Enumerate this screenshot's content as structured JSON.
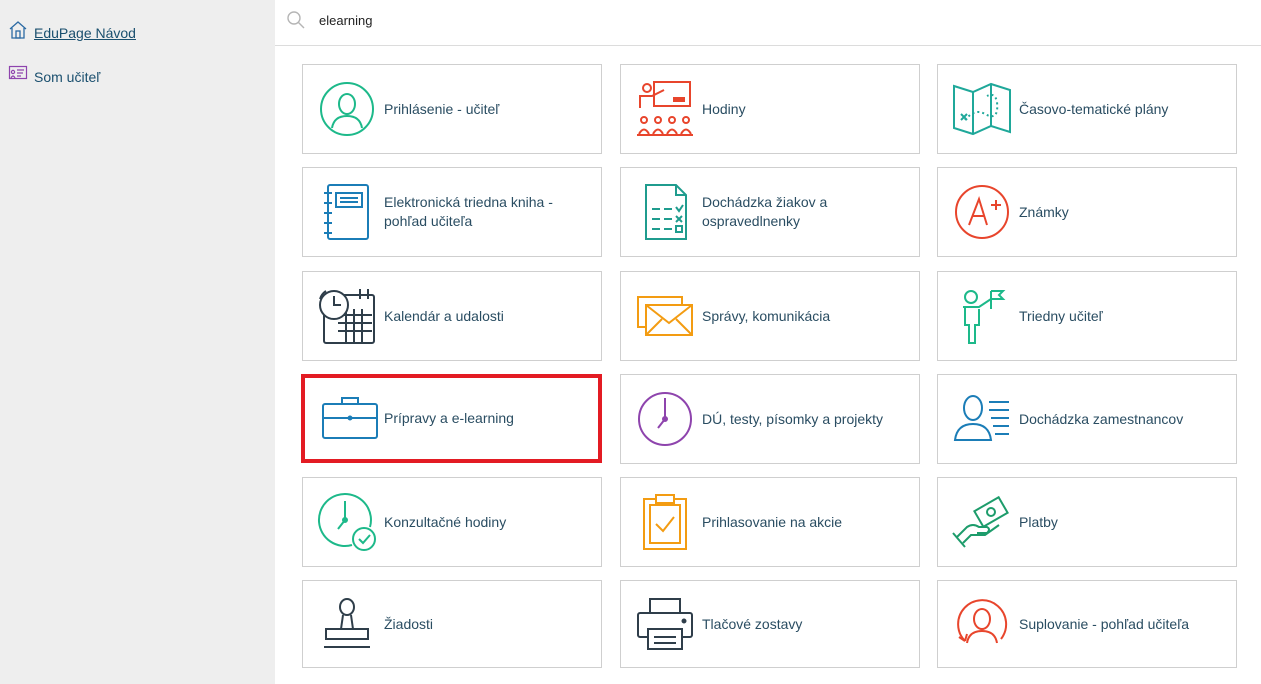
{
  "sidebar": {
    "items": [
      {
        "label": "EduPage Návod",
        "icon": "home-icon"
      },
      {
        "label": "Som učiteľ",
        "icon": "teacher-board-icon"
      }
    ]
  },
  "search": {
    "value": "elearning",
    "icon": "search-icon"
  },
  "highlight_color": "#e31b23",
  "tiles": [
    {
      "label": "Prihlásenie - učiteľ",
      "icon": "teacher-login-icon",
      "color": "#1db98a"
    },
    {
      "label": "Hodiny",
      "icon": "classroom-lesson-icon",
      "color": "#e8452c"
    },
    {
      "label": "Časovo-tematické plány",
      "icon": "treasure-map-icon",
      "color": "#1fa89a"
    },
    {
      "label": "Elektronická triedna kniha - pohľad učiteľa",
      "icon": "class-book-icon",
      "color": "#1b7db7"
    },
    {
      "label": "Dochádzka žiakov a ospravedlnenky",
      "icon": "attendance-sheet-icon",
      "color": "#1f9c8e"
    },
    {
      "label": "Známky",
      "icon": "grade-a-plus-icon",
      "color": "#e8452c"
    },
    {
      "label": "Kalendár a udalosti",
      "icon": "calendar-clock-icon",
      "color": "#2f3e4a"
    },
    {
      "label": "Správy, komunikácia",
      "icon": "envelopes-icon",
      "color": "#f39c12"
    },
    {
      "label": "Triedny učiteľ",
      "icon": "class-teacher-flag-icon",
      "color": "#1db98a"
    },
    {
      "label": "Prípravy a e-learning",
      "icon": "briefcase-icon",
      "color": "#1b7db7",
      "highlighted": true
    },
    {
      "label": "DÚ, testy, písomky a projekty",
      "icon": "clock-icon",
      "color": "#8e44ad"
    },
    {
      "label": "Dochádzka zamestnancov",
      "icon": "staff-attendance-icon",
      "color": "#1b7db7"
    },
    {
      "label": "Konzultačné hodiny",
      "icon": "consult-clock-check-icon",
      "color": "#1db98a"
    },
    {
      "label": "Prihlasovanie na akcie",
      "icon": "clipboard-check-icon",
      "color": "#f39c12"
    },
    {
      "label": "Platby",
      "icon": "hand-money-icon",
      "color": "#1d9c6b"
    },
    {
      "label": "Žiadosti",
      "icon": "stamp-icon",
      "color": "#2f3e4a"
    },
    {
      "label": "Tlačové zostavy",
      "icon": "printer-icon",
      "color": "#2f3e4a"
    },
    {
      "label": "Suplovanie - pohľad učiteľa",
      "icon": "substitute-teacher-icon",
      "color": "#e8452c"
    }
  ]
}
